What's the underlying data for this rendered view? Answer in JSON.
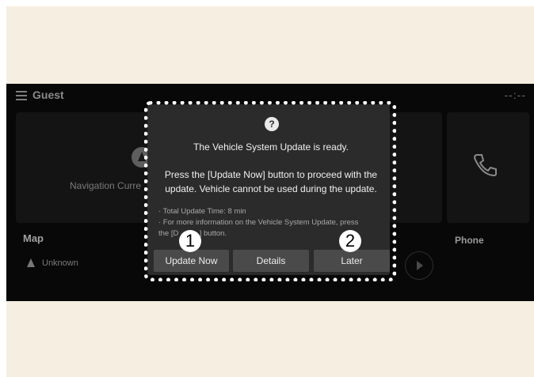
{
  "header": {
    "user": "Guest",
    "clock": "--:--"
  },
  "tiles": {
    "map_title": "Map",
    "map_location": "Unknown",
    "navigation_text": "Navigation Curre",
    "phone_title": "Phone"
  },
  "dialog": {
    "help_glyph": "?",
    "title": "The Vehicle System Update is ready.",
    "body": "Press the [Update Now] button to proceed with the update. Vehicle cannot be used during the update.",
    "note_time": "· Total Update Time: 8 min",
    "note_info_1": "· For more information on the Vehicle System Update, press",
    "note_info_2": "the [D          ] button.",
    "buttons": {
      "update_now": "Update Now",
      "details": "Details",
      "later": "Later"
    }
  },
  "callouts": {
    "one": "1",
    "two": "2"
  },
  "colors": {
    "background": "#f6efe1",
    "screen": "#080808",
    "dialog": "#2b2b2b",
    "button": "#4a4a4a"
  }
}
